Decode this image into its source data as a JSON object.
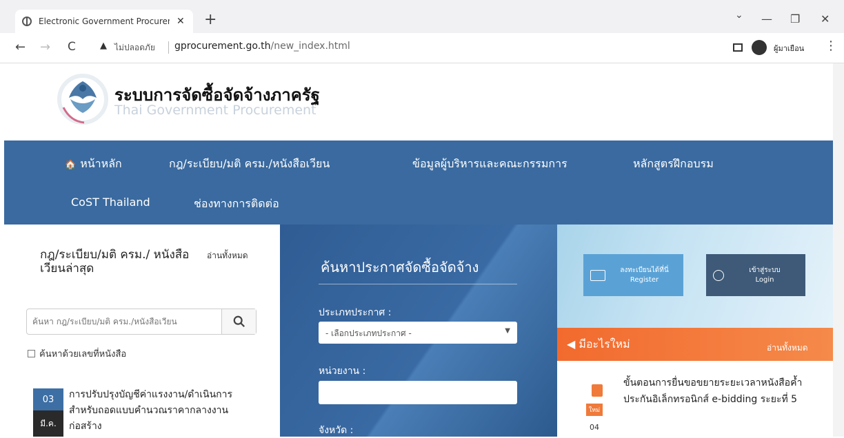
{
  "browser": {
    "tab_title": "Electronic Government Procuren",
    "new_tab_label": "+",
    "warning_text": "ไม่ปลอดภัย",
    "url_host": "gprocurement.go.th",
    "url_path": "/new_index.html",
    "profile_name": "ผู้มาเยือน",
    "back_label": "←",
    "forward_label": "→",
    "reload_label": "C",
    "tab_close_label": "✕",
    "min_label": "—",
    "max_label": "❐",
    "close_label": "✕",
    "chevron_label": "⌄",
    "menu_label": "⋮",
    "warning_icon_label": "▲"
  },
  "site": {
    "title": "ระบบการจัดซื้อจัดจ้างภาครัฐ",
    "subtitle": "Thai Government Procurement"
  },
  "nav": {
    "items": [
      {
        "label": "หน้าหลัก"
      },
      {
        "label": "กฎ/ระเบียบ/มติ ครม./หนังสือเวียน"
      },
      {
        "label": "ข้อมูลผู้บริหารและคณะกรรมการ"
      },
      {
        "label": "หลักสูตรฝึกอบรม"
      },
      {
        "label": "CoST Thailand"
      },
      {
        "label": "ช่องทางการติดต่อ"
      }
    ],
    "home_icon_label": "🏠"
  },
  "left": {
    "title": "กฎ/ระเบียบ/มติ ครม./ หนังสือเวียนล่าสุด",
    "read_all": "อ่านทั้งหมด",
    "search_placeholder": "ค้นหา กฎ/ระเบียบ/มติ ครม./หนังสือเวียน",
    "checkbox_label": "ค้นหาด้วยเลขที่หนังสือ",
    "news": [
      {
        "day": "03",
        "month": "มี.ค.",
        "text": "การปรับปรุงบัญชีค่าแรงงาน/ดำเนินการสำหรับถอดแบบคำนวณราคากลางงานก่อสร้าง"
      }
    ]
  },
  "middle": {
    "title": "ค้นหาประกาศจัดซื้อจัดจ้าง",
    "type_label": "ประเภทประกาศ :",
    "type_select": "- เลือกประเภทประกาศ -",
    "agency_label": "หน่วยงาน :",
    "province_label": "จังหวัด :"
  },
  "right": {
    "register_line1": "ลงทะเบียนได้ที่นี่",
    "register_line2": "Register",
    "login_line1": "เข้าสู่ระบบ",
    "login_line2": "Login",
    "whats_new": "มีอะไรใหม่",
    "read_all": "อ่านทั้งหมด",
    "news": [
      {
        "badge": "ใหม่",
        "date": "04",
        "text": "ขั้นตอนการยื่นขอขยายระยะเวลาหนังสือค้ำประกันอิเล็กทรอนิกส์ e-bidding ระยะที่ 5"
      }
    ]
  },
  "colors": {
    "nav_bg": "#3a6a9f",
    "orange": "#f26a2e",
    "register_btn": "#5aa2d6",
    "login_btn": "#3e5a78"
  }
}
